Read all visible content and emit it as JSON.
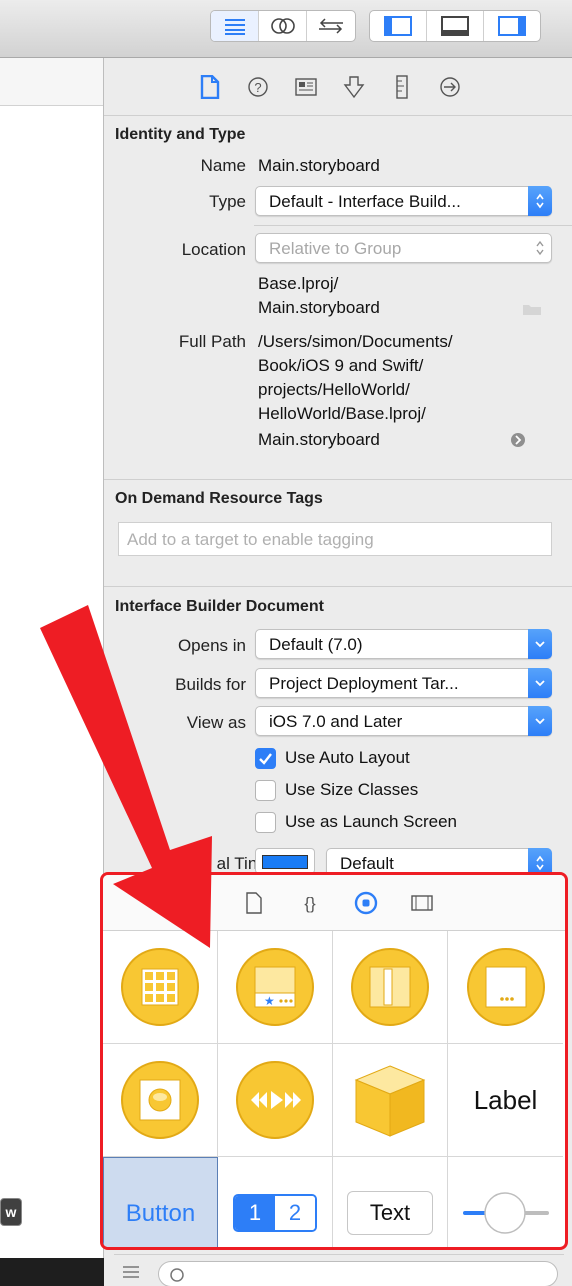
{
  "inspector": {
    "identity": {
      "title": "Identity and Type",
      "name_label": "Name",
      "name_value": "Main.storyboard",
      "type_label": "Type",
      "type_value": "Default - Interface Build...",
      "location_label": "Location",
      "location_value": "Relative to Group",
      "relative_path": [
        "Base.lproj/",
        "Main.storyboard"
      ],
      "fullpath_label": "Full Path",
      "fullpath_lines": [
        "/Users/simon/Documents/",
        "Book/iOS 9 and Swift/",
        "projects/HelloWorld/",
        "HelloWorld/Base.lproj/",
        "Main.storyboard"
      ]
    },
    "odr": {
      "title": "On Demand Resource Tags",
      "placeholder": "Add to a target to enable tagging"
    },
    "ibdoc": {
      "title": "Interface Builder Document",
      "opens_label": "Opens in",
      "opens_value": "Default (7.0)",
      "builds_label": "Builds for",
      "builds_value": "Project Deployment Tar...",
      "viewas_label": "View as",
      "viewas_value": "iOS 7.0 and Later",
      "autolayout": "Use Auto Layout",
      "autolayout_checked": true,
      "sizeclasses": "Use Size Classes",
      "sizeclasses_checked": false,
      "launch": "Use as Launch Screen",
      "launch_checked": false,
      "tint_label": "al Tint",
      "tint_value": "Default"
    }
  },
  "library": {
    "label_item": "Label",
    "button_item": "Button",
    "seg1": "1",
    "seg2": "2",
    "text_item": "Text"
  },
  "left": {
    "pill": "w"
  },
  "colors": {
    "accent": "#2d7ef7",
    "highlight": "#ee1d24",
    "object_yellow": "#f8c733"
  }
}
